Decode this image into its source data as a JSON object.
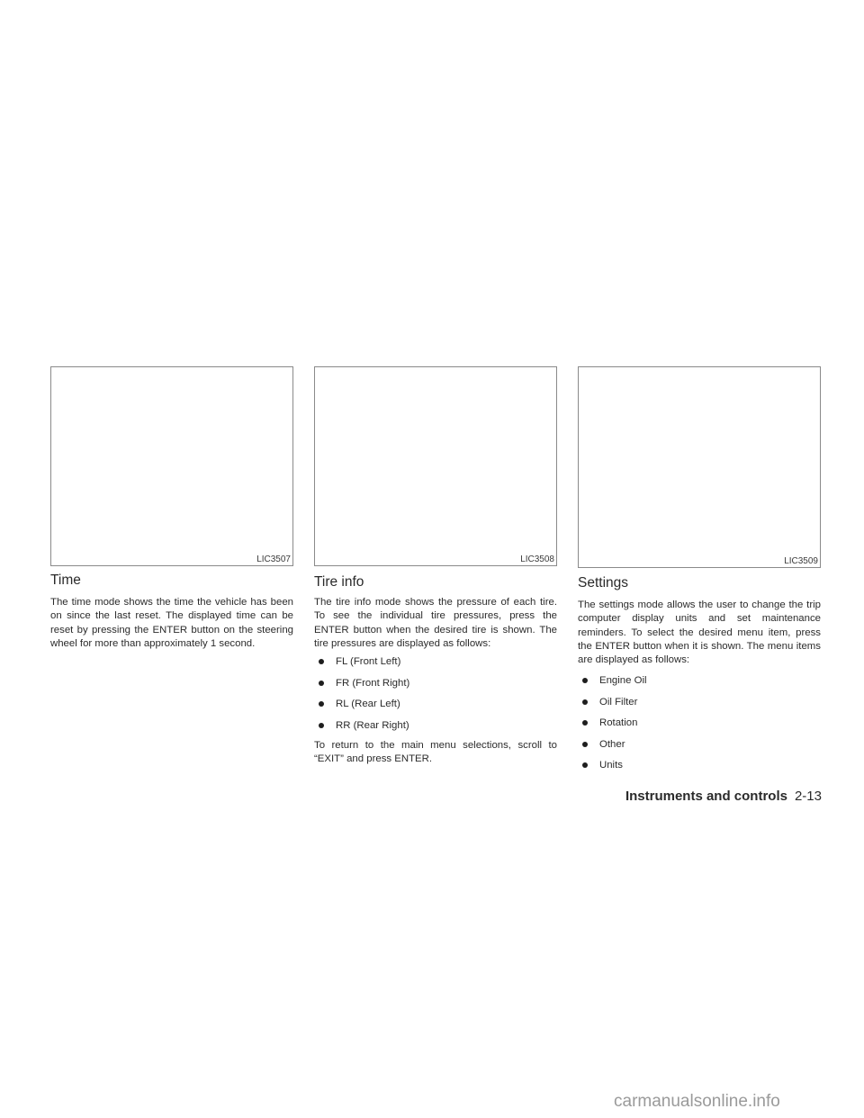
{
  "columns": [
    {
      "figure_label": "LIC3507",
      "heading": "Time",
      "paragraphs": [
        "The time mode shows the time the vehicle has been on since the last reset. The displayed time can be reset by pressing the ENTER button on the steering wheel for more than approximately 1 second."
      ],
      "bullets": []
    },
    {
      "figure_label": "LIC3508",
      "heading": "Tire info",
      "paragraphs": [
        "The tire info mode shows the pressure of each tire. To see the individual tire pressures, press the ENTER button when the desired tire is shown. The tire pressures are displayed as follows:",
        "To return to the main menu selections, scroll to “EXIT” and press ENTER."
      ],
      "bullets": [
        "FL (Front Left)",
        "FR (Front Right)",
        "RL (Rear Left)",
        "RR (Rear Right)"
      ]
    },
    {
      "figure_label": "LIC3509",
      "heading": "Settings",
      "paragraphs": [
        "The settings mode allows the user to change the trip computer display units and set maintenance reminders. To select the desired menu item, press the ENTER button when it is shown. The menu items are displayed as follows:"
      ],
      "bullets": [
        "Engine Oil",
        "Oil Filter",
        "Rotation",
        "Other",
        "Units"
      ]
    }
  ],
  "footer": {
    "section": "Instruments and controls",
    "page": "2-13"
  },
  "watermark": "carmanualsonline.info"
}
